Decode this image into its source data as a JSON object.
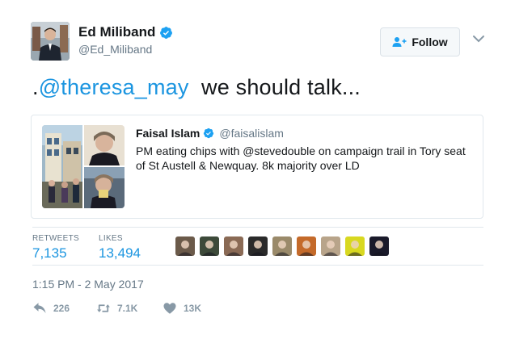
{
  "author": {
    "name": "Ed Miliband",
    "handle": "@Ed_Miliband"
  },
  "follow_button": {
    "label": "Follow"
  },
  "tweet": {
    "prefix": ".",
    "mention": "@theresa_may",
    "rest": "  we should talk..."
  },
  "quoted_tweet": {
    "name": "Faisal Islam",
    "handle": "@faisalislam",
    "text": "PM eating chips with @stevedouble on campaign trail in Tory seat of St Austell & Newquay. 8k majority over LD"
  },
  "stats": {
    "retweets_label": "RETWEETS",
    "retweets_value": "7,135",
    "likes_label": "LIKES",
    "likes_value": "13,494"
  },
  "likers": [
    {
      "name": "liker-1",
      "color": "#6b5a4a"
    },
    {
      "name": "liker-2",
      "color": "#3d4a3a"
    },
    {
      "name": "liker-3",
      "color": "#8a6a55"
    },
    {
      "name": "liker-4",
      "color": "#2a2a2a"
    },
    {
      "name": "liker-5",
      "color": "#9a8a6a"
    },
    {
      "name": "liker-6",
      "color": "#c46a2a"
    },
    {
      "name": "liker-7",
      "color": "#b8a48a"
    },
    {
      "name": "liker-8",
      "color": "#d8d820"
    },
    {
      "name": "liker-9",
      "color": "#1a1a2a"
    }
  ],
  "timestamp": "1:15 PM - 2 May 2017",
  "actions": {
    "reply_count": "226",
    "retweet_count": "7.1K",
    "like_count": "13K"
  },
  "colors": {
    "link": "#1b95e0",
    "secondary_text": "#657786",
    "verified": "#1da1f2",
    "action_icon": "#8899a6"
  }
}
